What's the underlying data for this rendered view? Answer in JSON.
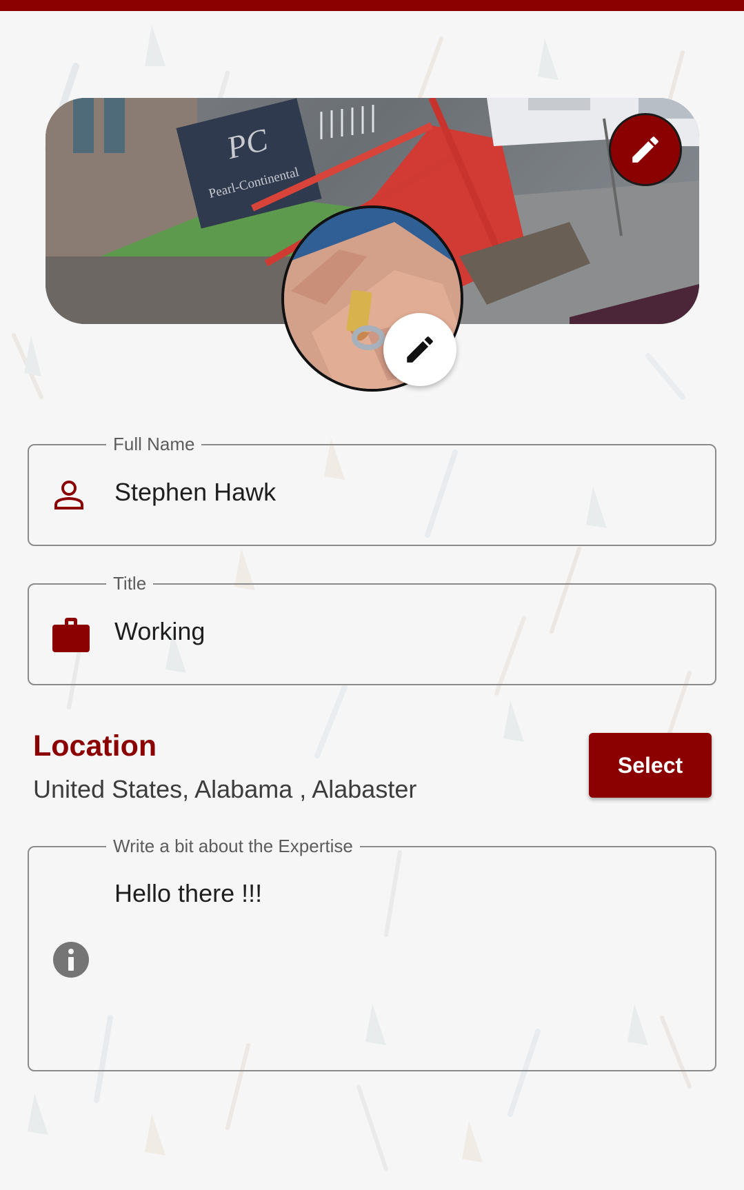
{
  "theme": {
    "accent": "#8b0000",
    "border": "#8a8a8a",
    "background": "#f6f6f6"
  },
  "cover": {
    "edit_icon": "pencil-icon",
    "sign_logo": "PC",
    "sign_text": "Pearl-Continental"
  },
  "avatar": {
    "edit_icon": "pencil-icon"
  },
  "full_name": {
    "label": "Full Name",
    "value": "Stephen Hawk",
    "icon": "person-icon"
  },
  "title": {
    "label": "Title",
    "value": "Working",
    "icon": "briefcase-icon"
  },
  "location": {
    "heading": "Location",
    "value": "United States, Alabama , Alabaster",
    "select_label": "Select"
  },
  "expertise": {
    "label": "Write a bit about the Expertise",
    "value": "Hello there !!!",
    "icon": "info-icon"
  }
}
